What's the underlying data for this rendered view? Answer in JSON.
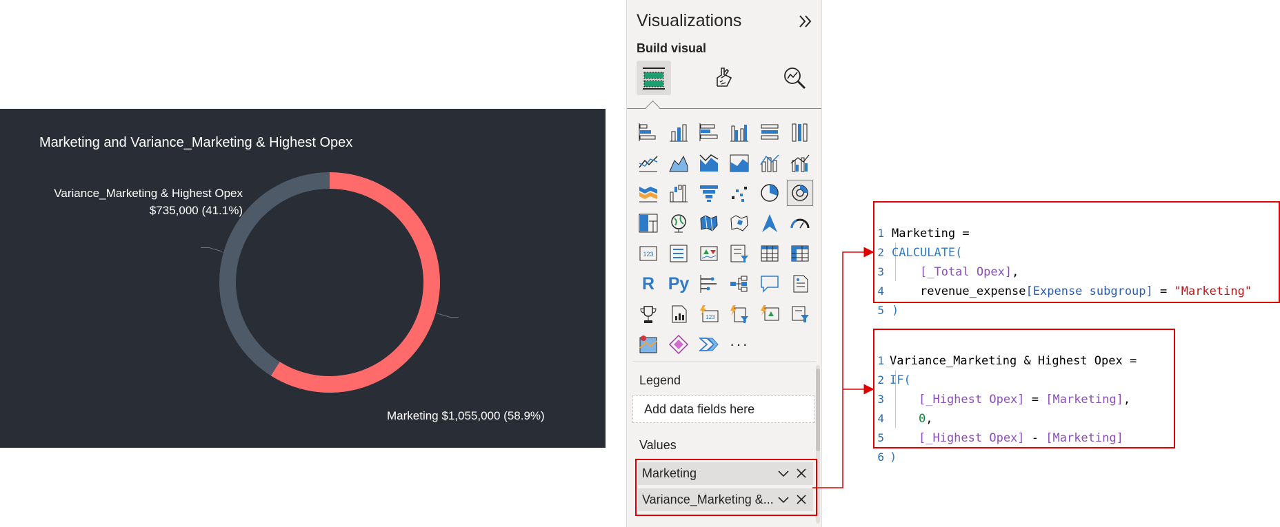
{
  "chart_data": {
    "type": "pie",
    "variant": "donut",
    "title": "Marketing and Variance_Marketing & Highest Opex",
    "slices": [
      {
        "name": "Marketing",
        "value": 1055000,
        "label": "Marketing $1,055,000 (58.9%)",
        "color": "#ff6b6b"
      },
      {
        "name": "Variance_Marketing & Highest Opex",
        "value": 735000,
        "label_line1": "Variance_Marketing & Highest Opex",
        "label_line2": "$735,000 (41.1%)",
        "color": "#4e5a68"
      }
    ],
    "background": "#282d36"
  },
  "viz_pane": {
    "title": "Visualizations",
    "build_label": "Build visual",
    "legend_label": "Legend",
    "legend_placeholder": "Add data fields here",
    "values_label": "Values",
    "values_fields": [
      "Marketing",
      "Variance_Marketing &..."
    ],
    "more_label": "···",
    "r_label": "R",
    "py_label": "Py"
  },
  "code_marketing": {
    "lines": [
      "1",
      "2",
      "3",
      "4",
      "5"
    ],
    "l1": "Marketing =",
    "l2": "CALCULATE(",
    "l3_meas": "[_Total Opex]",
    "l3_rest": ",",
    "l4_table": "revenue_expense",
    "l4_col": "[Expense subgroup]",
    "l4_eq": " = ",
    "l4_str": "\"Marketing\"",
    "l5": ")"
  },
  "code_variance": {
    "lines": [
      "1",
      "2",
      "3",
      "4",
      "5",
      "6"
    ],
    "l1": "Variance_Marketing & Highest Opex =",
    "l2": "IF(",
    "l3_m1": "[_Highest Opex]",
    "l3_eq": " = ",
    "l3_m2": "[Marketing]",
    "l3_rest": ",",
    "l4_num": "0",
    "l4_rest": ",",
    "l5_m1": "[_Highest Opex]",
    "l5_op": " - ",
    "l5_m2": "[Marketing]",
    "l6": ")"
  },
  "colors": {
    "highlight_border": "#e00000",
    "accent_blue": "#2d7bc9"
  }
}
